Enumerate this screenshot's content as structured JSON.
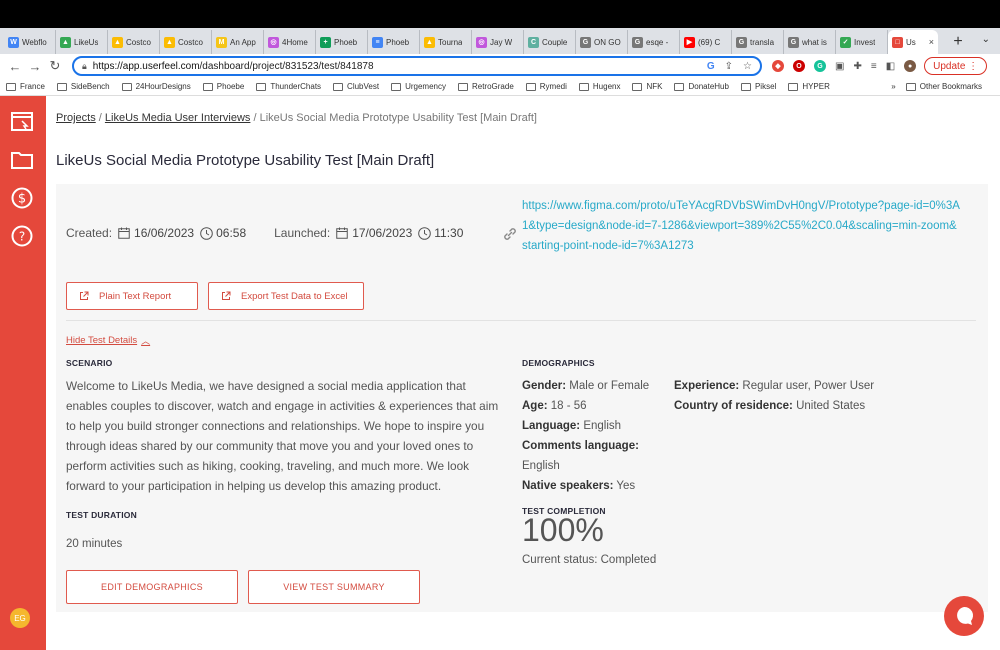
{
  "browser": {
    "tabs": [
      {
        "label": "Webflo",
        "color": "#4285f4",
        "glyph": "W"
      },
      {
        "label": "LikeUs",
        "color": "#34a853",
        "glyph": "▲"
      },
      {
        "label": "Costco",
        "color": "#fbbc04",
        "glyph": "▲"
      },
      {
        "label": "Costco",
        "color": "#fbbc04",
        "glyph": "▲"
      },
      {
        "label": "An App",
        "color": "#f5c518",
        "glyph": "M"
      },
      {
        "label": "4Home",
        "color": "#c158dc",
        "glyph": "◎"
      },
      {
        "label": "Phoeb",
        "color": "#0f9d58",
        "glyph": "+"
      },
      {
        "label": "Phoeb",
        "color": "#4285f4",
        "glyph": "≡"
      },
      {
        "label": "Tourna",
        "color": "#fbbc04",
        "glyph": "▲"
      },
      {
        "label": "Jay W",
        "color": "#c158dc",
        "glyph": "◎"
      },
      {
        "label": "Couple",
        "color": "#5fb0a0",
        "glyph": "C"
      },
      {
        "label": "ON GO",
        "color": "#777777",
        "glyph": "G"
      },
      {
        "label": "esqe -",
        "color": "#777777",
        "glyph": "G"
      },
      {
        "label": "(69) C",
        "color": "#ff0000",
        "glyph": "▶"
      },
      {
        "label": "transla",
        "color": "#777777",
        "glyph": "G"
      },
      {
        "label": "what is",
        "color": "#777777",
        "glyph": "G"
      },
      {
        "label": "Invest",
        "color": "#34a853",
        "glyph": "✓"
      },
      {
        "label": "Us",
        "color": "#e5483b",
        "glyph": "□",
        "active": true
      }
    ],
    "tab_close": "×",
    "new_tab": "+",
    "tab_overflow": "⌄",
    "url_host": "https://app.userfeel.com",
    "url_path": "/dashboard/project/831523/test/841878",
    "update_label": "Update",
    "bookmarks": [
      "France",
      "SideBench",
      "24HourDesigns",
      "Phoebe",
      "ThunderChats",
      "ClubVest",
      "Urgemency",
      "RetroGrade",
      "Rymedi",
      "Hugenx",
      "NFK",
      "DonateHub",
      "Piksel",
      "HYPER"
    ],
    "bookmarks_more": "»",
    "other_bookmarks": "Other Bookmarks"
  },
  "sidebar": {
    "icons": [
      "dashboard-icon",
      "folder-icon",
      "dollar-icon",
      "help-icon"
    ],
    "avatar_initials": "EG"
  },
  "breadcrumb": {
    "projects": "Projects",
    "sep1": " / ",
    "project": "LikeUs Media User Interviews",
    "sep2": " / ",
    "current": "LikeUs Social Media Prototype Usability Test [Main Draft]"
  },
  "page_title": "LikeUs Social Media Prototype Usability Test [Main Draft]",
  "meta": {
    "created_label": "Created:",
    "created_date": "16/06/2023",
    "created_time": "06:58",
    "launched_label": "Launched:",
    "launched_date": "17/06/2023",
    "launched_time": "11:30",
    "prototype_url": "https://www.figma.com/proto/uTeYAcgRDVbSWimDvH0ngV/Prototype?page-id=0%3A1&type=design&node-id=7-1286&viewport=389%2C55%2C0.04&scaling=min-zoom&starting-point-node-id=7%3A1273"
  },
  "actions": {
    "plain_text_report": "Plain Text Report",
    "export_excel": "Export Test Data to Excel",
    "hide_details": "Hide Test Details",
    "edit_demographics": "EDIT DEMOGRAPHICS",
    "view_summary": "VIEW TEST SUMMARY"
  },
  "scenario": {
    "label": "SCENARIO",
    "text": "Welcome to LikeUs Media, we have designed a social media application that enables couples to discover, watch and engage in activities & experiences that aim to help you build stronger connections and relationships. We hope to inspire you through ideas shared by our community that move you and your loved ones to perform activities such as hiking, cooking, traveling, and much more. We look forward to your participation in helping us develop this amazing product."
  },
  "duration": {
    "label": "TEST DURATION",
    "value": "20 minutes"
  },
  "demographics": {
    "label": "DEMOGRAPHICS",
    "gender_label": "Gender:",
    "gender": "Male or Female",
    "age_label": "Age:",
    "age": "18 - 56",
    "language_label": "Language:",
    "language": "English",
    "comments_language_label": "Comments language:",
    "comments_language": "English",
    "native_label": "Native speakers:",
    "native": "Yes",
    "experience_label": "Experience:",
    "experience": "Regular user, Power User",
    "country_label": "Country of residence:",
    "country": "United States"
  },
  "completion": {
    "label": "TEST COMPLETION",
    "value": "100%",
    "status": "Current status: Completed"
  },
  "colors": {
    "brand": "#e5483b",
    "link": "#27a9c8",
    "card_bg": "#f6f6f6"
  }
}
